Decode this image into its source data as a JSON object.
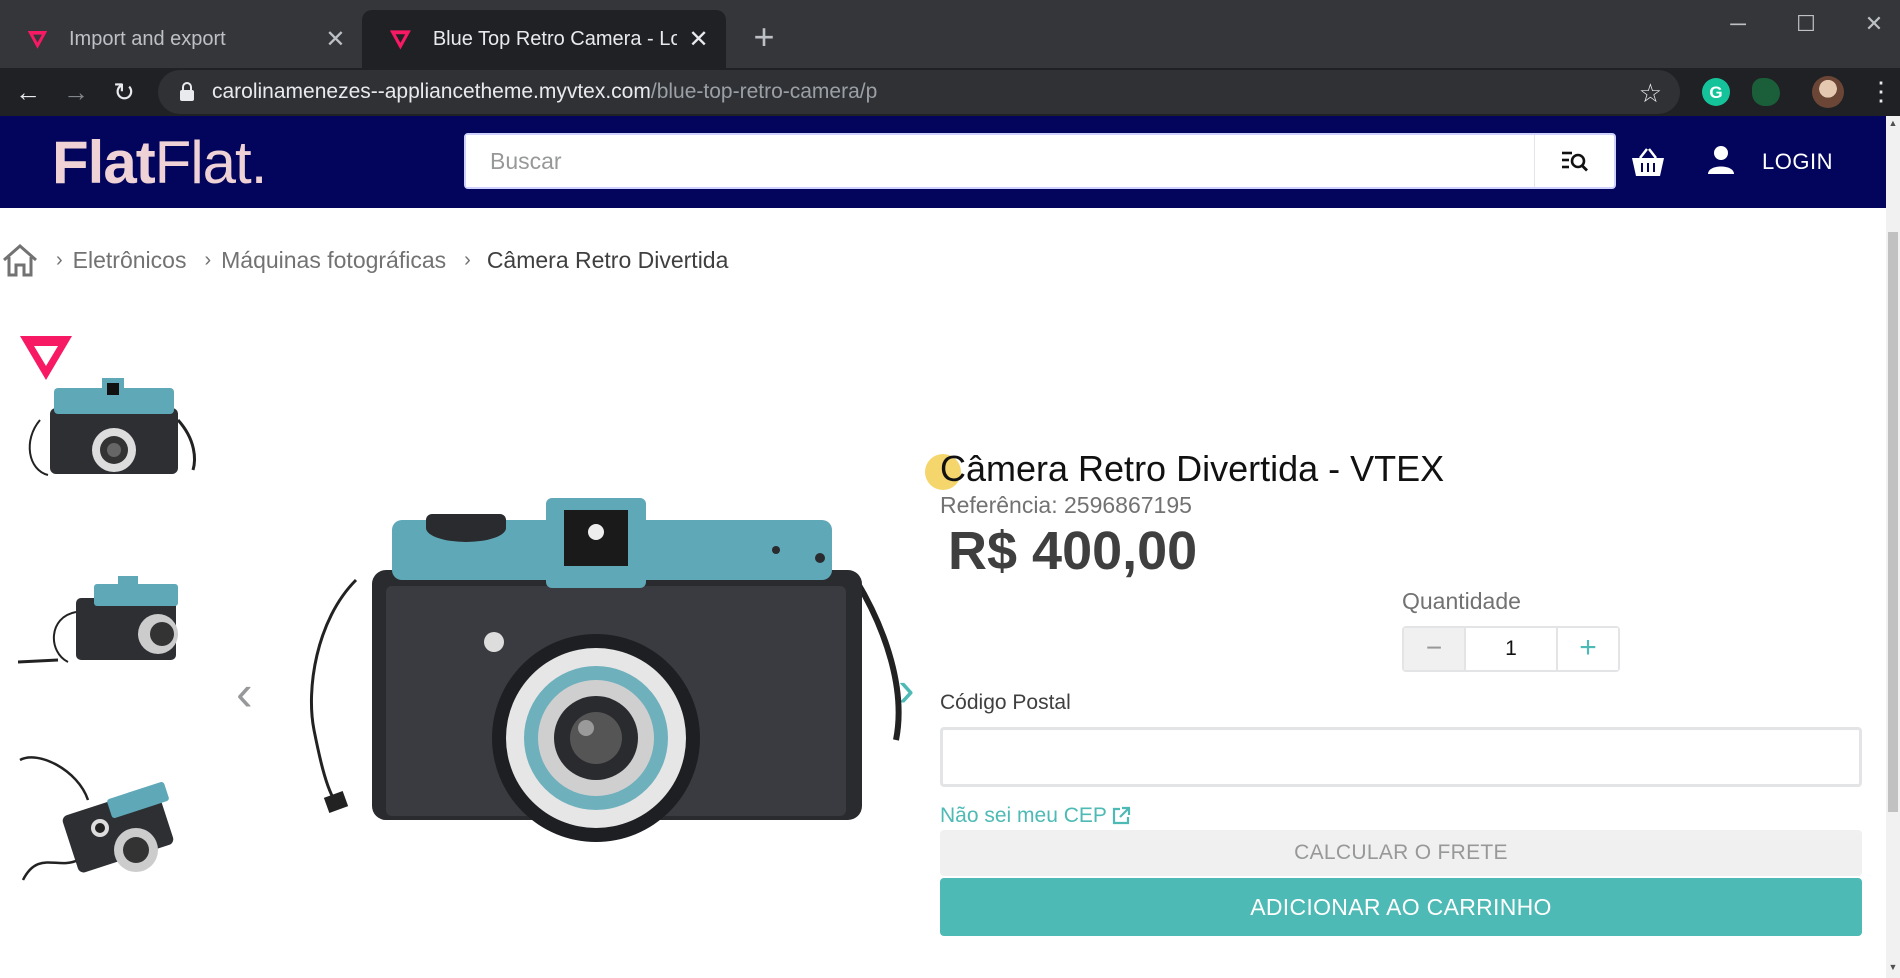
{
  "browser": {
    "tabs": [
      {
        "title": "Import and export",
        "active": false
      },
      {
        "title": "Blue Top Retro Camera - Loja de",
        "active": true
      }
    ],
    "new_tab_icon": "+",
    "close_icon": "✕",
    "url_host": "carolinamenezes--appliancetheme.myvtex.com",
    "url_path": "/blue-top-retro-camera/p"
  },
  "header": {
    "logo_bold": "Flat",
    "logo_light": "Flat.",
    "search_placeholder": "Buscar",
    "login_label": "LOGIN",
    "background": "#03055c"
  },
  "breadcrumb": {
    "items": [
      "Eletrônicos",
      "Máquinas fotográficas"
    ],
    "current": "Câmera Retro Divertida"
  },
  "product": {
    "name": "Câmera Retro Divertida - VTEX",
    "reference": "Referência: 2596867195",
    "price": "R$ 400,00",
    "quantity_label": "Quantidade",
    "quantity_value": "1",
    "postal_label": "Código Postal",
    "cep_link": "Não sei meu CEP",
    "calc_button": "CALCULAR O FRETE",
    "add_button": "ADICIONAR AO CARRINHO",
    "accent": "#4ebab5"
  }
}
